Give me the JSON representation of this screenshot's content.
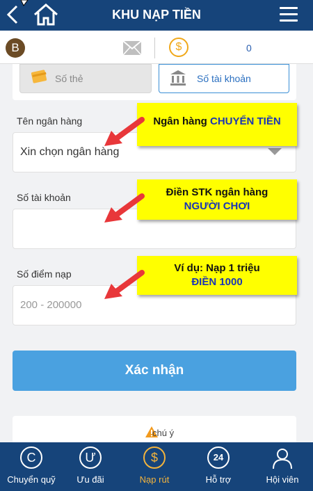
{
  "header": {
    "title": "KHU NẠP TIỀN"
  },
  "infobar": {
    "badge": "B",
    "coin_symbol": "$",
    "balance": "0"
  },
  "methods": {
    "card": "Số thẻ",
    "bank": "Số tài khoản"
  },
  "form": {
    "bank_label": "Tên ngân hàng",
    "bank_value": "Xin chọn ngân hàng",
    "account_label": "Số tài khoản",
    "account_value": "",
    "points_label": "Số điểm nạp",
    "points_placeholder": "200 - 200000",
    "submit": "Xác nhận"
  },
  "notice": {
    "text": "chú ý"
  },
  "callouts": {
    "bank_line1": "Ngân hàng ",
    "bank_line1_blue": "CHUYỂN TIỀN",
    "account_line1": "Điền STK ngân hàng",
    "account_line2": "NGƯỜI CHƠI",
    "points_line1": "Ví dụ: Nạp 1 triệu",
    "points_line2": "ĐIỀN 1000"
  },
  "nav": [
    {
      "icon": "C",
      "label": "Chuyển quỹ"
    },
    {
      "icon": "Ư",
      "label": "Ưu đãi"
    },
    {
      "icon": "$",
      "label": "Nạp rút"
    },
    {
      "icon": "24",
      "label": "Hỗ trợ"
    },
    {
      "icon": "",
      "label": "Hội viên"
    }
  ],
  "colors": {
    "header_bg": "#16447a",
    "accent_blue": "#4aa1e0",
    "active_nav": "#f2b33d",
    "callout_yellow": "#ffff00",
    "arrow_red": "#e8373a"
  }
}
